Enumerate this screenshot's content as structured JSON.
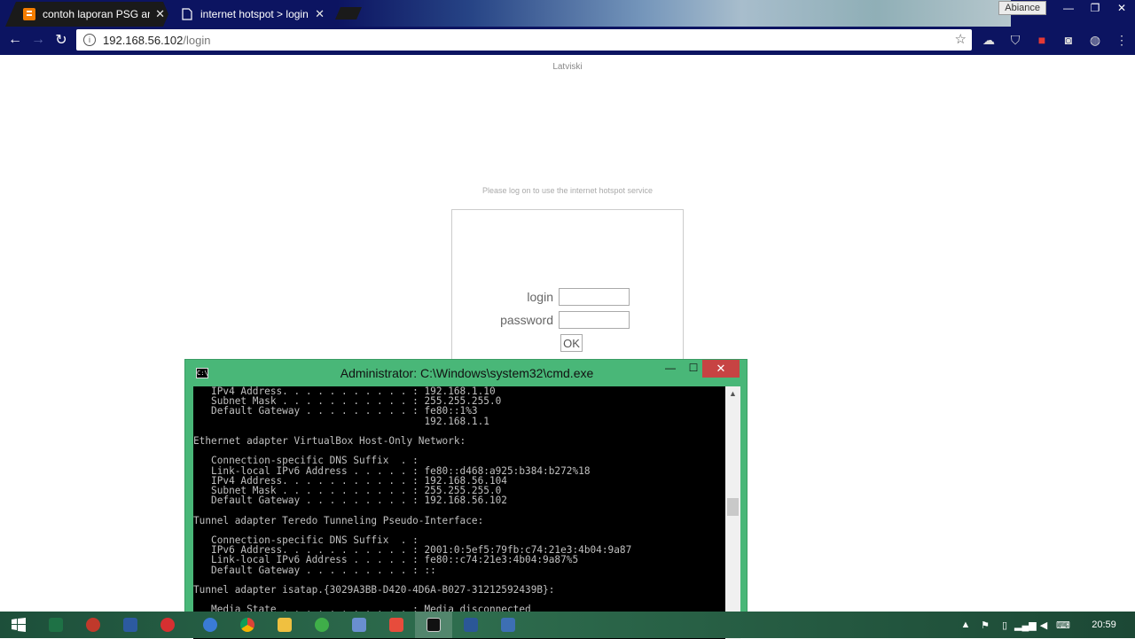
{
  "browser": {
    "tabs": [
      {
        "title": "contoh laporan PSG ana",
        "favicon": "blogger-icon",
        "state": "inactive"
      },
      {
        "title": "internet hotspot > login",
        "favicon": "page-icon",
        "state": "active"
      }
    ],
    "profile_button": "Abiance",
    "address": {
      "host": "192.168.56.102",
      "path": "/login"
    }
  },
  "page": {
    "title": "Latviski",
    "notice": "Please log on to use the internet hotspot service",
    "login_label": "login",
    "password_label": "password",
    "login_value": "",
    "password_value": "",
    "ok_label": "OK"
  },
  "cmd": {
    "title": "Administrator: C:\\Windows\\system32\\cmd.exe",
    "icon_text": "C:\\",
    "output": "   IPv4 Address. . . . . . . . . . . : 192.168.1.10\n   Subnet Mask . . . . . . . . . . . : 255.255.255.0\n   Default Gateway . . . . . . . . . : fe80::1%3\n                                       192.168.1.1\n\nEthernet adapter VirtualBox Host-Only Network:\n\n   Connection-specific DNS Suffix  . :\n   Link-local IPv6 Address . . . . . : fe80::d468:a925:b384:b272%18\n   IPv4 Address. . . . . . . . . . . : 192.168.56.104\n   Subnet Mask . . . . . . . . . . . : 255.255.255.0\n   Default Gateway . . . . . . . . . : 192.168.56.102\n\nTunnel adapter Teredo Tunneling Pseudo-Interface:\n\n   Connection-specific DNS Suffix  . :\n   IPv6 Address. . . . . . . . . . . : 2001:0:5ef5:79fb:c74:21e3:4b04:9a87\n   Link-local IPv6 Address . . . . . : fe80::c74:21e3:4b04:9a87%5\n   Default Gateway . . . . . . . . . : ::\n\nTunnel adapter isatap.{3029A3BB-D420-4D6A-B027-31212592439B}:\n\n   Media State . . . . . . . . . . . : Media disconnected\n   Connection-specific DNS Suffix  . :"
  },
  "taskbar": {
    "clock": "20:59",
    "apps": [
      {
        "name": "start-button",
        "color": "#ffffff"
      },
      {
        "name": "excel-icon",
        "color": "#1e7145"
      },
      {
        "name": "record-icon",
        "color": "#c0392b"
      },
      {
        "name": "monitor-icon",
        "color": "#2c5aa0"
      },
      {
        "name": "shield-app-icon",
        "color": "#d63031"
      },
      {
        "name": "browser-app-icon",
        "color": "#3a7bd5"
      },
      {
        "name": "chrome-icon",
        "color": "#f2b01e"
      },
      {
        "name": "file-explorer-icon",
        "color": "#f0c040"
      },
      {
        "name": "paint-icon",
        "color": "#3fae49"
      },
      {
        "name": "virtualbox-icon",
        "color": "#6a8fd0"
      },
      {
        "name": "recorder-app-icon",
        "color": "#e74c3c"
      },
      {
        "name": "cmd-icon",
        "color": "#111111"
      },
      {
        "name": "word-icon",
        "color": "#2b5797"
      },
      {
        "name": "network-app-icon",
        "color": "#3d6fb4"
      }
    ]
  },
  "colors": {
    "chrome_theme": "#0c1461",
    "cmd_frame": "#49b778",
    "close_red": "#c74343",
    "taskbar": "#1d4f3a"
  }
}
